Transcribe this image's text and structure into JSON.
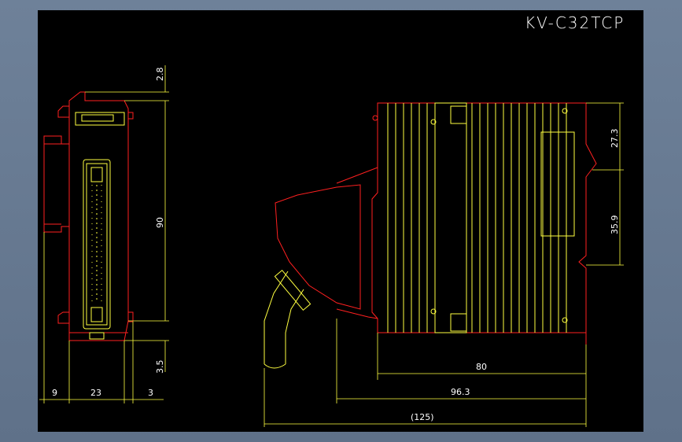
{
  "drawing": {
    "title": "KV-C32TCP",
    "colors": {
      "background": "#000000",
      "frame": "#6b7d94",
      "outline": "#ff2020",
      "detail": "#ffff40",
      "dimension": "#ffffff"
    }
  },
  "dimensions": {
    "front_view": {
      "top_offset": "2.8",
      "height": "90",
      "bottom_offset": "3.5",
      "left_width": "9",
      "mid_width": "23",
      "right_width": "3"
    },
    "side_view": {
      "upper_height": "27.3",
      "lower_height": "35.9",
      "depth_body": "80",
      "depth_with_connector": "96.3",
      "overall_depth": "(125)"
    }
  }
}
